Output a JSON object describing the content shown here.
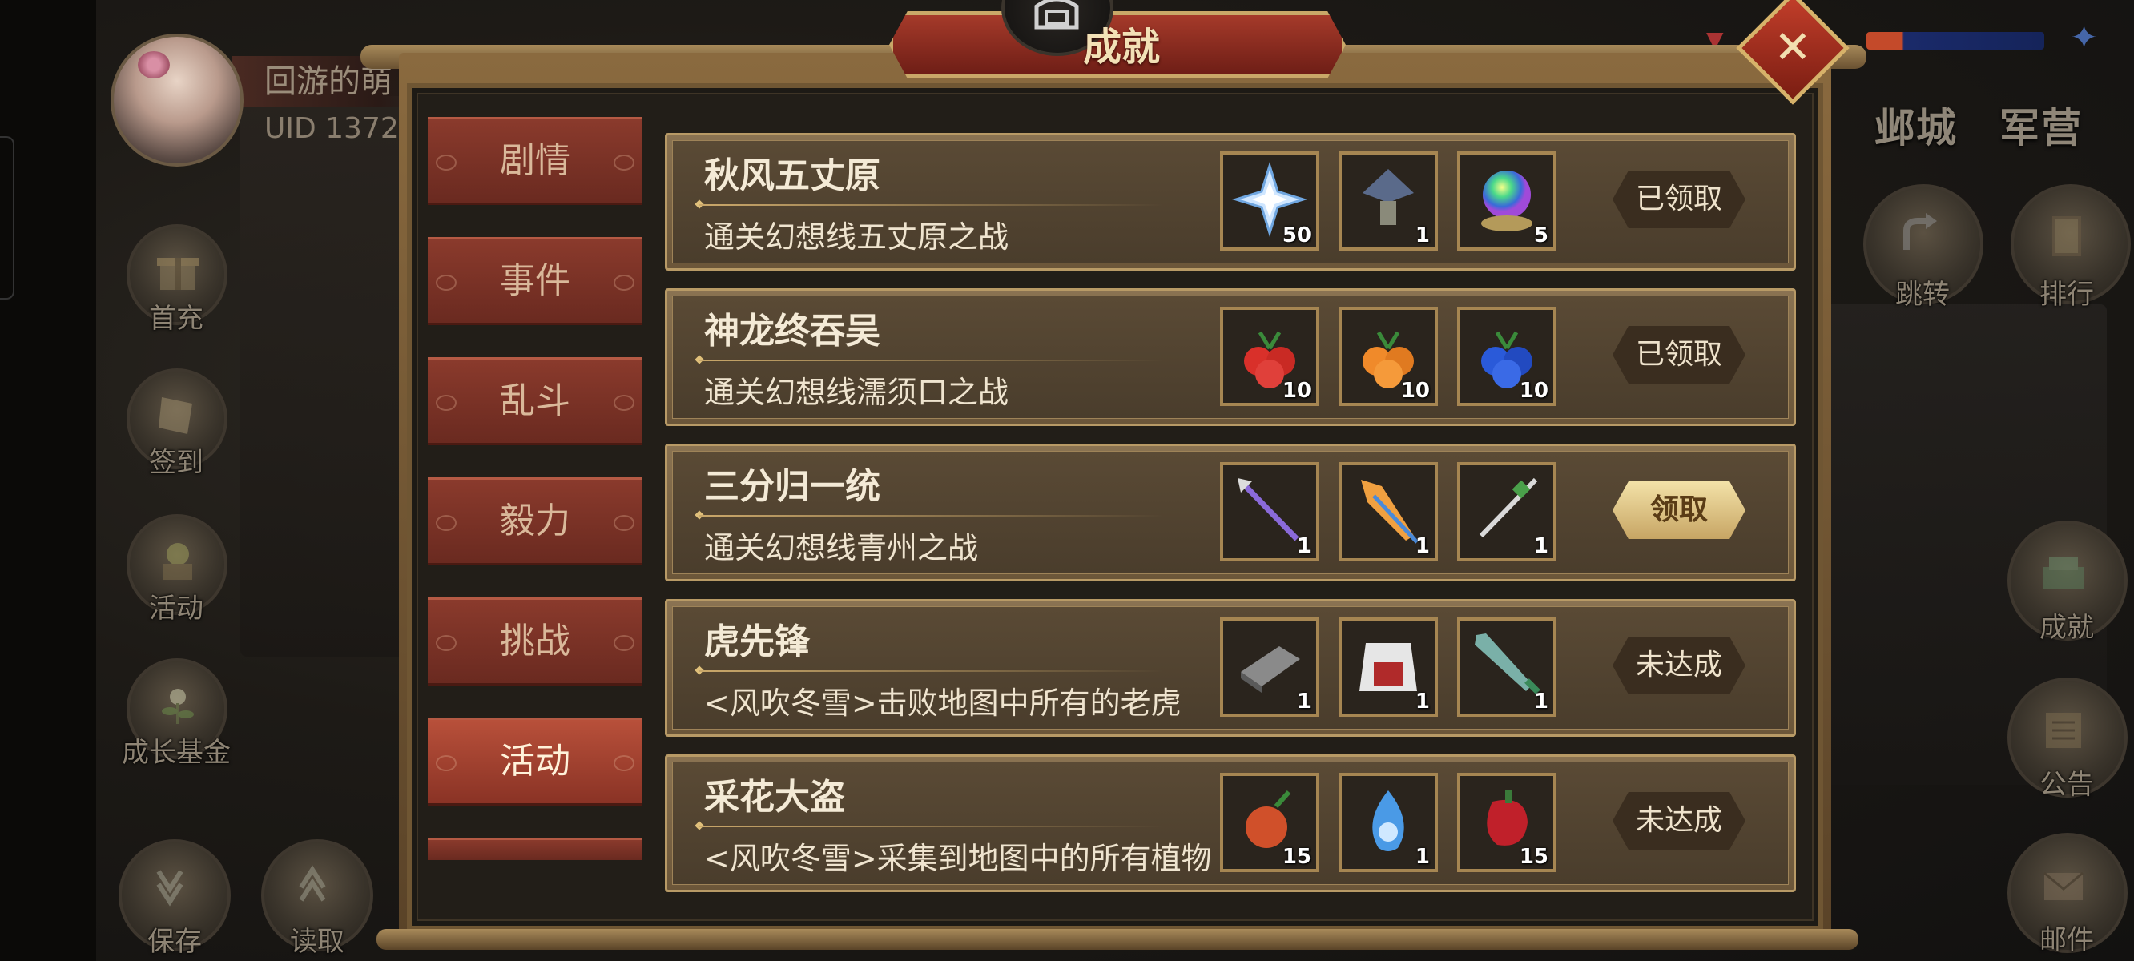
{
  "player": {
    "name": "回游的萌",
    "uid": "UID  1372"
  },
  "left_menu": [
    {
      "label": "首充",
      "icon": "gift-icon"
    },
    {
      "label": "签到",
      "icon": "scroll-icon"
    },
    {
      "label": "活动",
      "icon": "flower-basket-icon"
    },
    {
      "label": "成长基金",
      "icon": "plant-icon"
    },
    {
      "label": "保存",
      "icon": "save-icon"
    },
    {
      "label": "读取",
      "icon": "load-icon"
    }
  ],
  "right_tabs": [
    "邺城",
    "军营"
  ],
  "right_menu": [
    {
      "label": "跳转",
      "icon": "jump-arrow-icon"
    },
    {
      "label": "排行",
      "icon": "ranking-plaque-icon"
    },
    {
      "label": "成就",
      "icon": "achievement-icon"
    },
    {
      "label": "公告",
      "icon": "notice-scroll-icon"
    },
    {
      "label": "邮件",
      "icon": "mail-icon"
    }
  ],
  "dialog": {
    "title": "成就",
    "close_label": "✕"
  },
  "categories": [
    {
      "label": "剧情",
      "active": false
    },
    {
      "label": "事件",
      "active": false
    },
    {
      "label": "乱斗",
      "active": false
    },
    {
      "label": "毅力",
      "active": false
    },
    {
      "label": "挑战",
      "active": false
    },
    {
      "label": "活动",
      "active": true
    }
  ],
  "achievements": [
    {
      "title": "秋风五丈原",
      "description": "通关幻想线五丈原之战",
      "rewards": [
        {
          "icon": "ice-crystal-icon",
          "count": "50"
        },
        {
          "icon": "lantern-icon",
          "count": "1"
        },
        {
          "icon": "rainbow-orb-icon",
          "count": "5"
        }
      ],
      "status": "已领取",
      "status_type": "claimed"
    },
    {
      "title": "神龙终吞吴",
      "description": "通关幻想线濡须口之战",
      "rewards": [
        {
          "icon": "red-fruit-icon",
          "count": "10"
        },
        {
          "icon": "orange-fruit-icon",
          "count": "10"
        },
        {
          "icon": "blue-fruit-icon",
          "count": "10"
        }
      ],
      "status": "已领取",
      "status_type": "claimed"
    },
    {
      "title": "三分归一统",
      "description": "通关幻想线青州之战",
      "rewards": [
        {
          "icon": "purple-spear-icon",
          "count": "1"
        },
        {
          "icon": "flame-blade-icon",
          "count": "1"
        },
        {
          "icon": "green-sword-icon",
          "count": "1"
        }
      ],
      "status": "领取",
      "status_type": "claimable"
    },
    {
      "title": "虎先锋",
      "description": "<风吹冬雪>击败地图中所有的老虎",
      "rewards": [
        {
          "icon": "book-icon",
          "count": "1"
        },
        {
          "icon": "armor-icon",
          "count": "1"
        },
        {
          "icon": "broadsword-icon",
          "count": "1"
        }
      ],
      "status": "未达成",
      "status_type": "locked"
    },
    {
      "title": "采花大盗",
      "description": "<风吹冬雪>采集到地图中的所有植物",
      "rewards": [
        {
          "icon": "radish-icon",
          "count": "15"
        },
        {
          "icon": "blue-flame-icon",
          "count": "1"
        },
        {
          "icon": "red-pepper-icon",
          "count": "15"
        }
      ],
      "status": "未达成",
      "status_type": "locked"
    }
  ],
  "colors": {
    "tab_red": "#8a3a2c",
    "tab_active": "#b8503a",
    "row_gold_border": "#b89a66",
    "claim_gold": "#f3e2a8"
  }
}
